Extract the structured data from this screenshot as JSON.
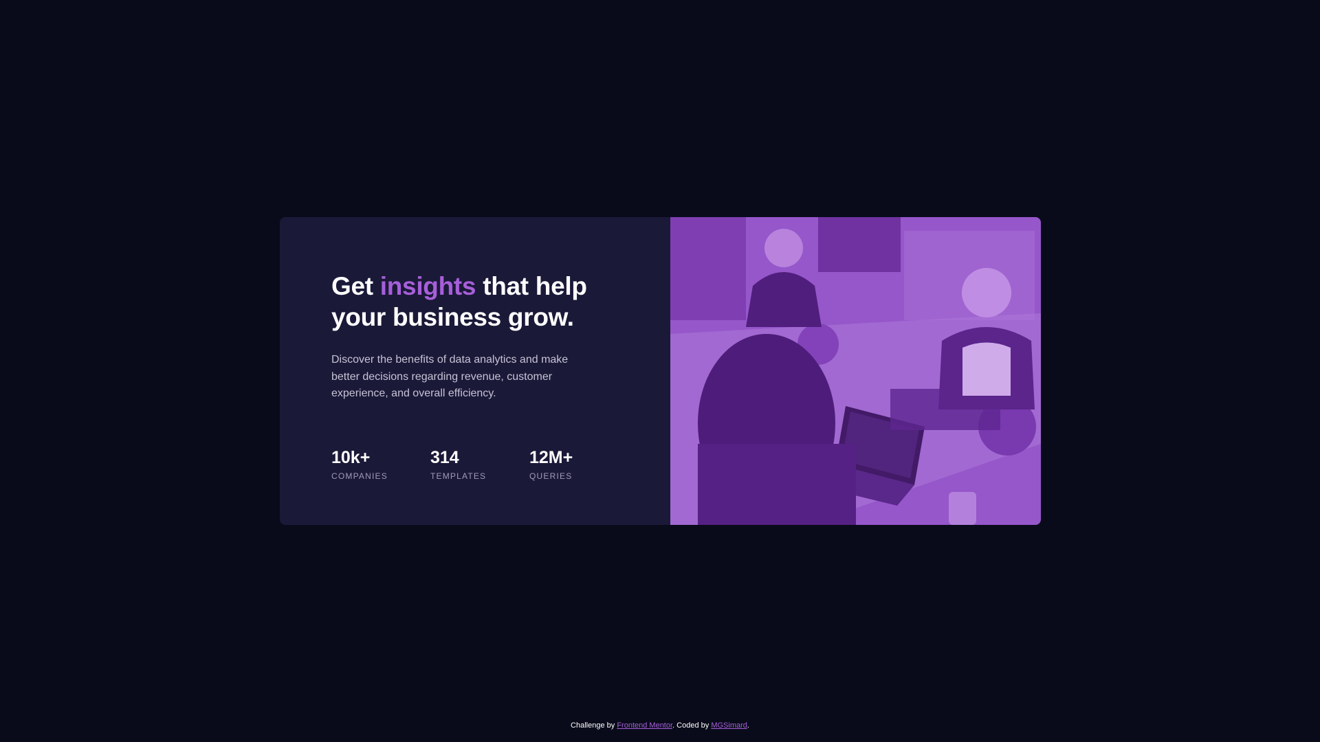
{
  "hero": {
    "title_prefix": "Get ",
    "title_accent": "insights",
    "title_suffix": " that help your business grow.",
    "description": "Discover the benefits of data analytics and make better decisions regarding revenue, customer experience, and overall efficiency."
  },
  "stats": [
    {
      "value": "10k+",
      "label": "COMPANIES"
    },
    {
      "value": "314",
      "label": "TEMPLATES"
    },
    {
      "value": "12M+",
      "label": "QUERIES"
    }
  ],
  "footer": {
    "prefix": "Challenge by ",
    "link1": "Frontend Mentor",
    "middle": ". Coded by ",
    "link2": "MGSimard",
    "suffix": "."
  },
  "colors": {
    "page_bg": "#090b1a",
    "card_bg": "#1b1938",
    "accent": "#a75fd9",
    "image_tint": "#8a48c4"
  }
}
